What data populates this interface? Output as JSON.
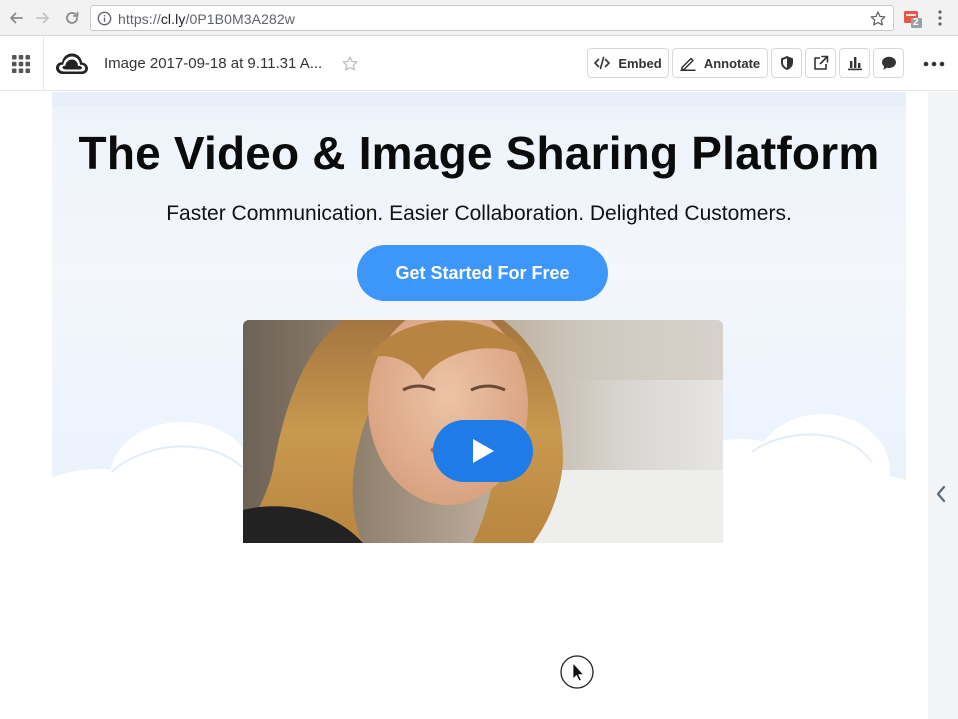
{
  "browser": {
    "url_prefix": "https://",
    "url_host": "cl.ly",
    "url_path": "/0P1B0M3A282w",
    "extension_badge": "2"
  },
  "toolbar": {
    "file_title": "Image 2017-09-18 at 9.11.31 A...",
    "embed_label": "Embed",
    "annotate_label": "Annotate",
    "icons": [
      "apps-grid-icon",
      "cloudapp-logo-icon",
      "star-icon",
      "code-icon",
      "pencil-icon",
      "shield-icon",
      "share-icon",
      "bar-chart-icon",
      "comment-icon",
      "more-icon"
    ]
  },
  "hero": {
    "title": "The Video & Image Sharing Platform",
    "subtitle": "Faster Communication. Easier Collaboration. Delighted Customers.",
    "cta_label": "Get Started For Free"
  },
  "colors": {
    "cta": "#3d97fa",
    "play": "#1f7be8",
    "hero_bg": "#eef3fb"
  }
}
